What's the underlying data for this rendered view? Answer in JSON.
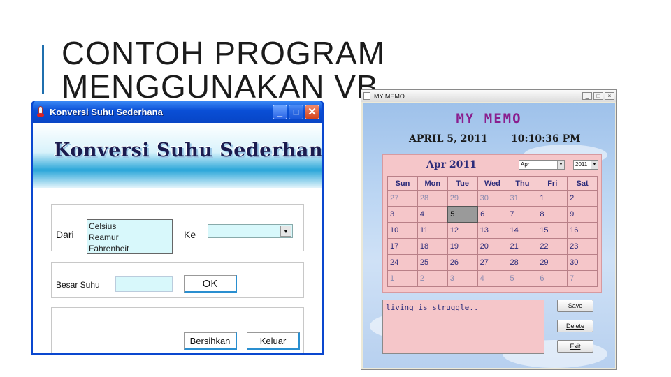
{
  "slide": {
    "title_line1": "CONTOH PROGRAM",
    "title_line2": "MENGGUNAKAN VB"
  },
  "converter": {
    "window_title": "Konversi Suhu Sederhana",
    "banner": "Konversi Suhu Sederhana",
    "from_label": "Dari",
    "to_label": "Ke",
    "options": [
      "Celsius",
      "Reamur",
      "Fahrenheit"
    ],
    "amount_label": "Besar Suhu",
    "ok_label": "OK",
    "clear_label": "Bersihkan",
    "exit_label": "Keluar",
    "colors": {
      "titlebar": "#0a4fd6",
      "field": "#d8f8fb",
      "button_accent": "#2a8fd0"
    }
  },
  "memo": {
    "window_title": "MY MEMO",
    "heading": "MY MEMO",
    "date": "APRIL 5, 2011",
    "time": "10:10:36 PM",
    "calendar": {
      "month_label": "Apr 2011",
      "month_select": "Apr",
      "year_select": "2011",
      "weekdays": [
        "Sun",
        "Mon",
        "Tue",
        "Wed",
        "Thu",
        "Fri",
        "Sat"
      ],
      "weeks": [
        [
          "27",
          "28",
          "29",
          "30",
          "31",
          "1",
          "2"
        ],
        [
          "3",
          "4",
          "5",
          "6",
          "7",
          "8",
          "9"
        ],
        [
          "10",
          "11",
          "12",
          "13",
          "14",
          "15",
          "16"
        ],
        [
          "17",
          "18",
          "19",
          "20",
          "21",
          "22",
          "23"
        ],
        [
          "24",
          "25",
          "26",
          "27",
          "28",
          "29",
          "30"
        ],
        [
          "1",
          "2",
          "3",
          "4",
          "5",
          "6",
          "7"
        ]
      ],
      "selected_day": "5"
    },
    "note": "living is struggle..",
    "buttons": {
      "save": "Save",
      "delete": "Delete",
      "exit": "Exit"
    },
    "colors": {
      "heading": "#8a1e8e",
      "calendar_bg": "#f5c6c9",
      "text": "#2c2c7a"
    }
  }
}
